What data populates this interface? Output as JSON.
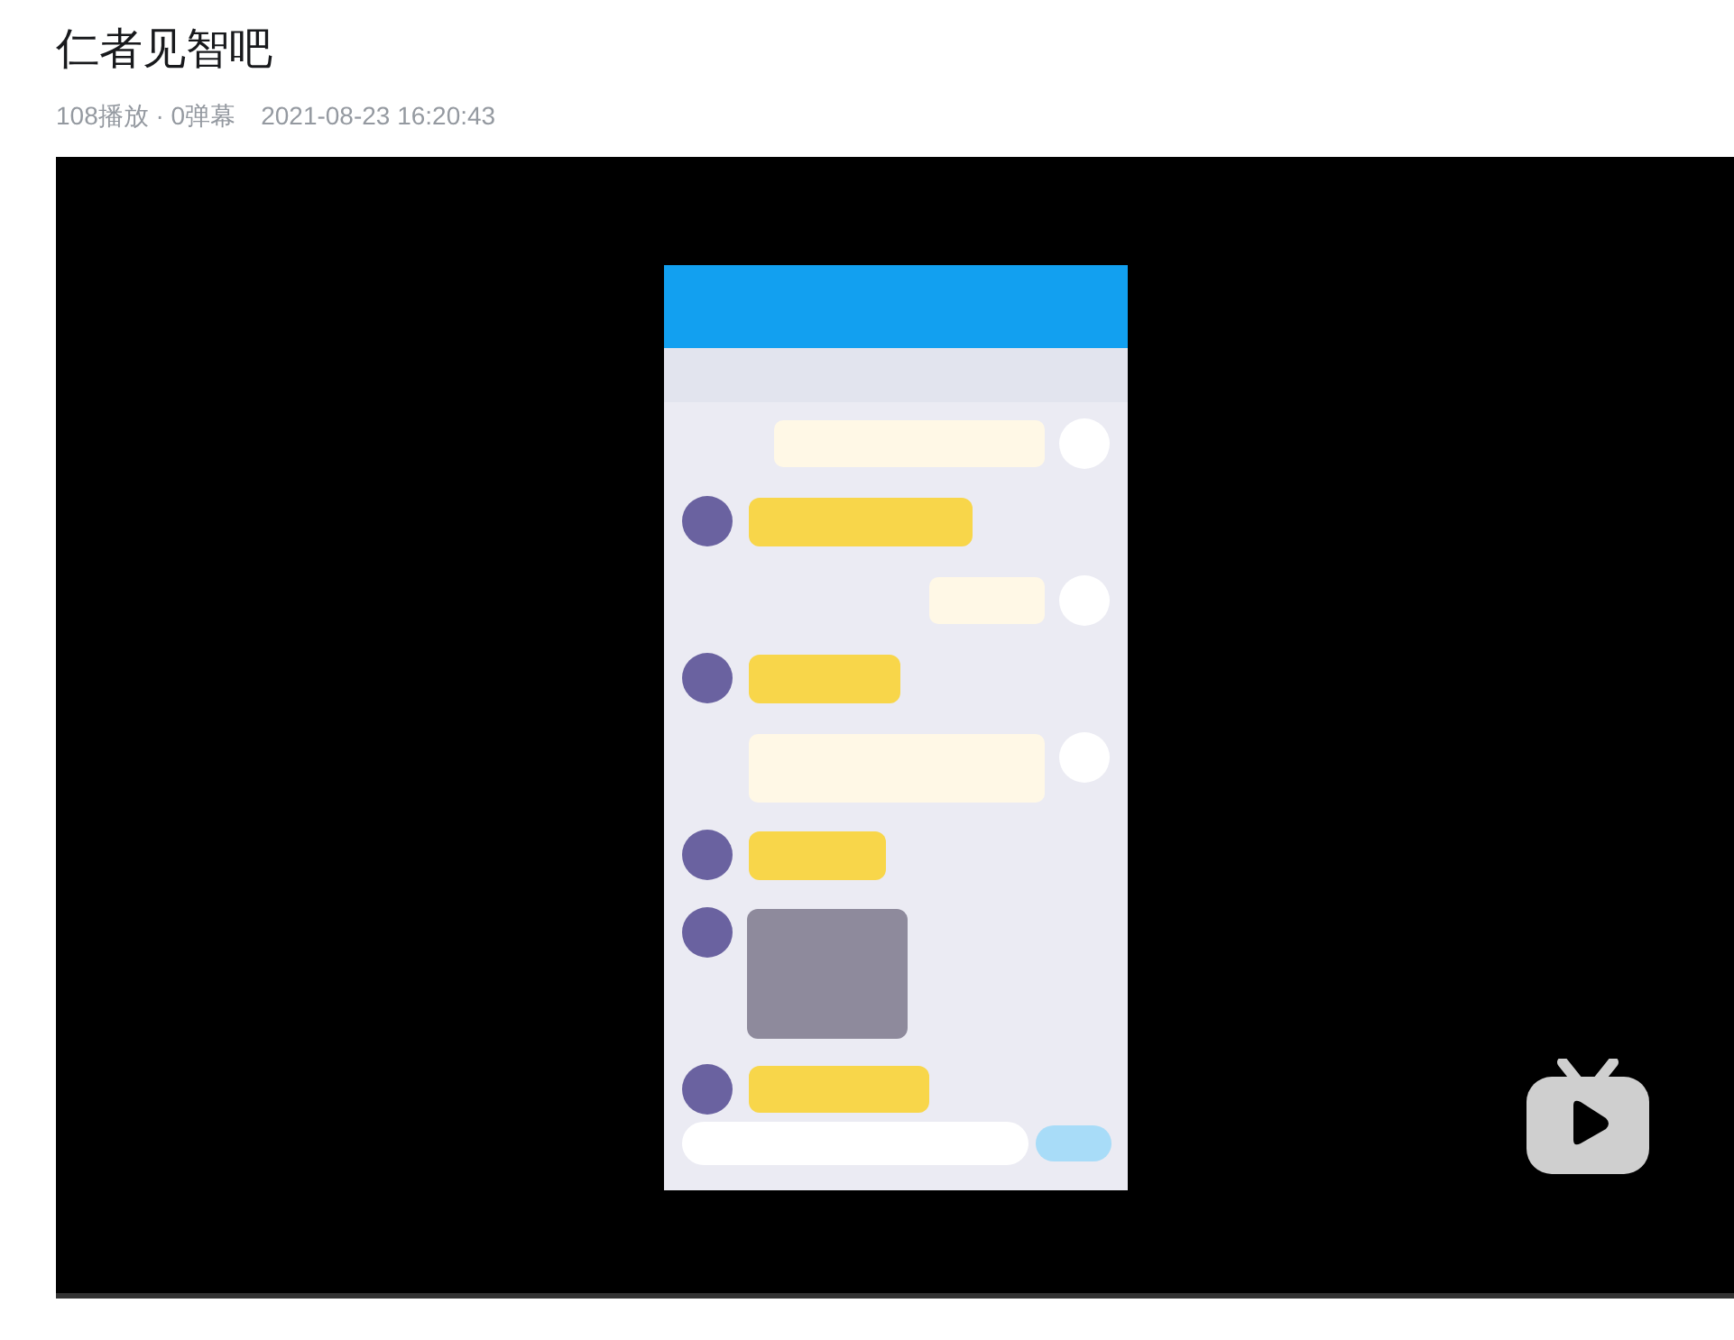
{
  "video": {
    "title": "仁者见智吧",
    "stats": "108播放 · 0弹幕",
    "date": "2021-08-23 16:20:43"
  }
}
